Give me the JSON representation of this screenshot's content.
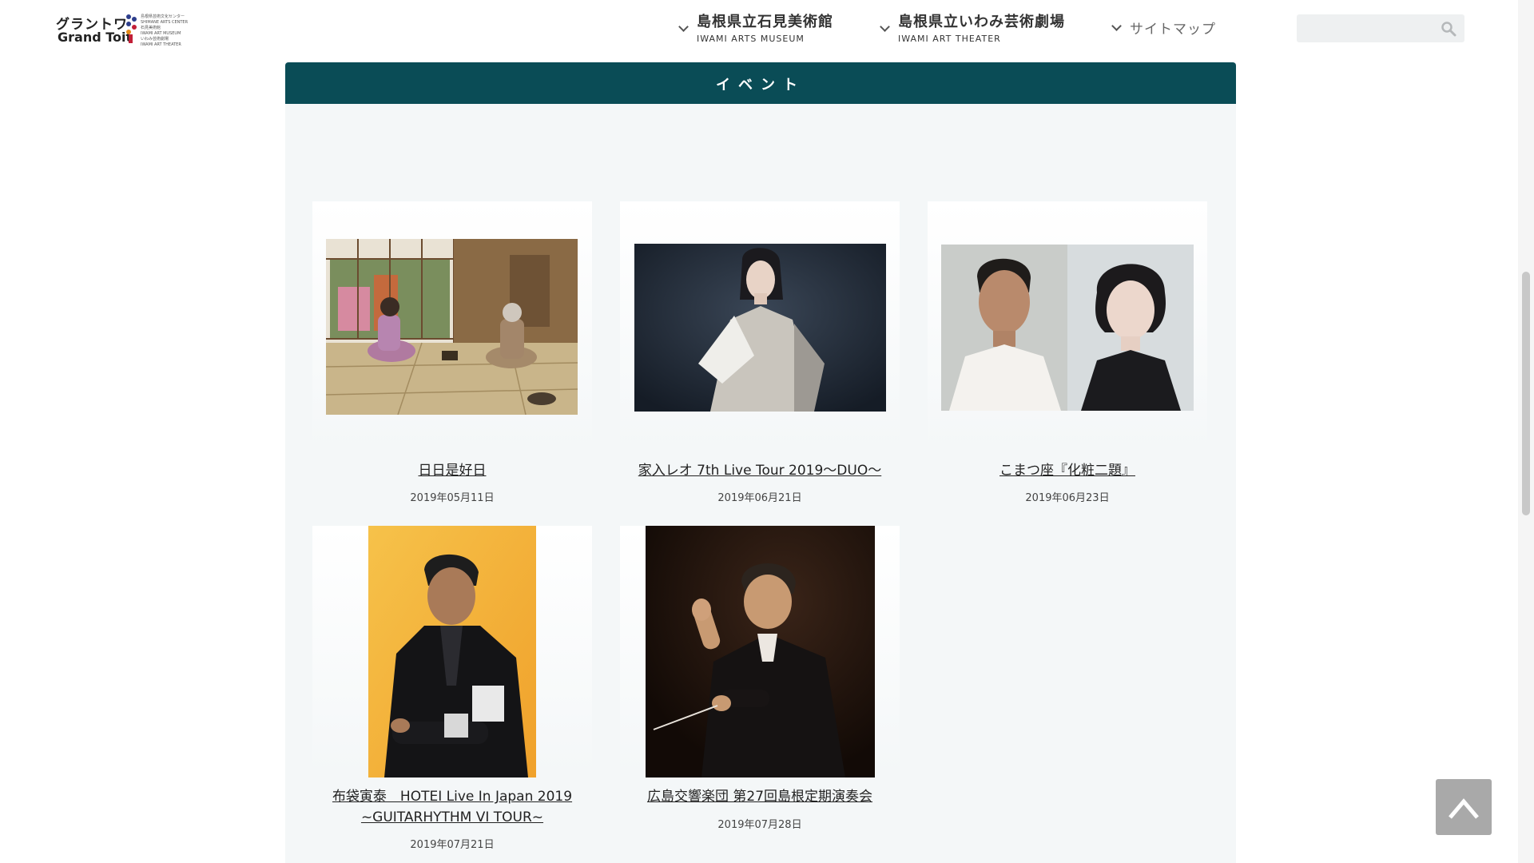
{
  "logo": {
    "name_jp": "グラントワ",
    "name_en": "Grand Toit",
    "sub_lines": [
      "島根県芸術文化センター",
      "SHIMANE ARTS CENTER",
      "石見美術館",
      "IWAMI ART MUSEUM",
      "いわみ芸術劇場",
      "IWAMI ART THEATER"
    ],
    "mark_colors": [
      "#2d3e8c",
      "#c21f37",
      "#e58b1b"
    ]
  },
  "nav": [
    {
      "title": "島根県立石見美術館",
      "sub": "IWAMI ARTS MUSEUM"
    },
    {
      "title": "島根県立いわみ芸術劇場",
      "sub": "IWAMI ART THEATER"
    }
  ],
  "sitemap_label": "サイトマップ",
  "search": {
    "placeholder": "",
    "icon": "search-icon"
  },
  "section": {
    "title": "イベント",
    "accent": "#0a4c56"
  },
  "events": [
    {
      "title": "日日是好日",
      "date": "2019年05月11日",
      "image": "tea-room-photo"
    },
    {
      "title": "家入レオ 7th Live Tour 2019〜DUO〜",
      "date": "2019年06月21日",
      "image": "singer-portrait"
    },
    {
      "title": "こまつ座『化粧二題』",
      "date": "2019年06月23日",
      "image": "actors-portrait"
    },
    {
      "title": "布袋寅泰　HOTEI Live In Japan 2019",
      "title2": "~GUITARHYTHM VI TOUR~",
      "date": "2019年07月21日",
      "image": "guitarist-portrait"
    },
    {
      "title": "広島交響楽団 第27回島根定期演奏会",
      "date": "2019年07月28日",
      "image": "conductor-photo"
    }
  ],
  "to_top_icon": "chevron-up-icon"
}
